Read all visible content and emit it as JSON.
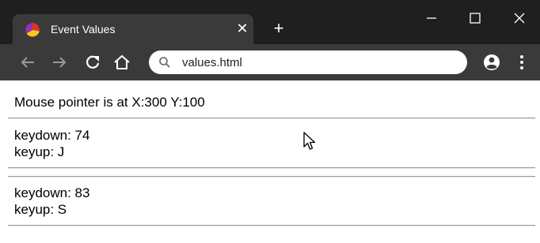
{
  "browser": {
    "tab": {
      "title": "Event Values",
      "close_icon": "close-icon"
    },
    "new_tab_icon": "plus-icon",
    "address_bar": {
      "url": "values.html"
    },
    "window_controls": [
      "minimize-icon",
      "maximize-icon",
      "close-icon"
    ],
    "colors": {
      "chrome_dark": "#1f1f1f",
      "chrome_tab": "#3a3a3a"
    }
  },
  "page": {
    "mouse_position": "Mouse pointer is at X:300 Y:100",
    "events": [
      {
        "keydown": "keydown: 74",
        "keyup": "keyup: J"
      },
      {
        "keydown": "keydown: 83",
        "keyup": "keyup: S"
      }
    ]
  }
}
